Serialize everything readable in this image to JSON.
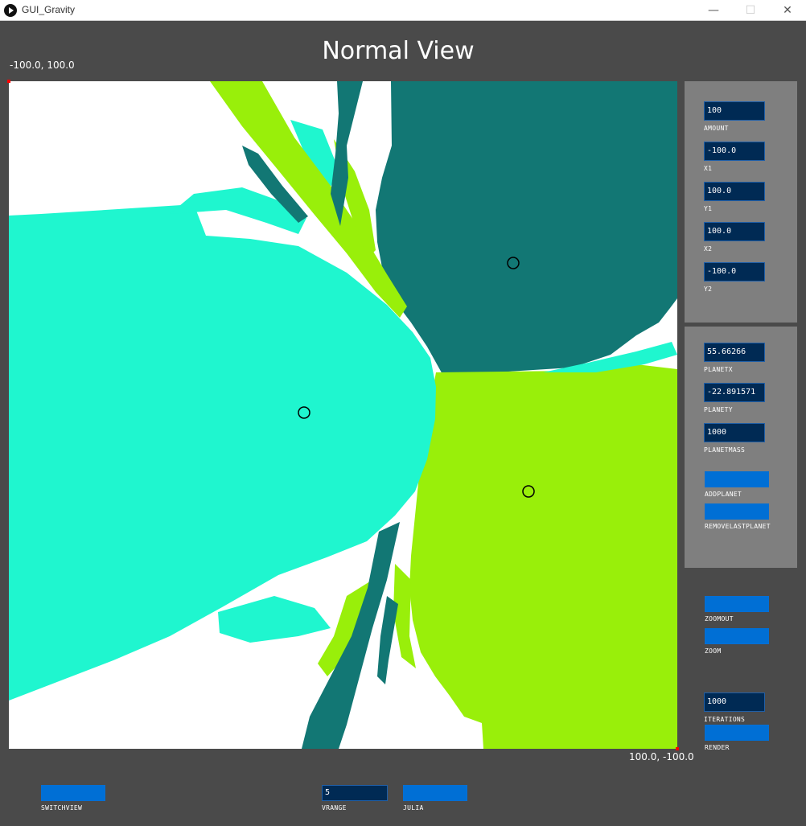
{
  "window": {
    "title": "GUI_Gravity",
    "minimize": "—",
    "maximize": "☐",
    "close": "✕"
  },
  "view_title": "Normal View",
  "coords": {
    "top_left": "-100.0, 100.0",
    "bottom_right": "100.0, -100.0"
  },
  "canvas": {
    "colors": {
      "cyan": "#1ff6cf",
      "teal": "#127774",
      "lime": "#99ef0a",
      "white": "#ffffff"
    },
    "planets": [
      {
        "name": "planet-1"
      },
      {
        "name": "planet-2"
      },
      {
        "name": "planet-3"
      }
    ]
  },
  "range_panel": {
    "amount": {
      "value": "100",
      "label": "AMOUNT"
    },
    "x1": {
      "value": "-100.0",
      "label": "X1"
    },
    "y1": {
      "value": "100.0",
      "label": "Y1"
    },
    "x2": {
      "value": "100.0",
      "label": "X2"
    },
    "y2": {
      "value": "-100.0",
      "label": "Y2"
    }
  },
  "planet_panel": {
    "planetx": {
      "value": "55.66266",
      "label": "PLANETX"
    },
    "planety": {
      "value": "-22.891571",
      "label": "PLANETY"
    },
    "planetmass": {
      "value": "1000",
      "label": "PLANETMASS"
    },
    "addplanet_label": "ADDPLANET",
    "removelastplanet_label": "REMOVELASTPLANET"
  },
  "zoom": {
    "zoomout_label": "ZOOMOUT",
    "zoom_label": "ZOOM"
  },
  "render": {
    "iterations": {
      "value": "1000",
      "label": "ITERATIONS"
    },
    "render_label": "RENDER"
  },
  "bottom": {
    "switchview_label": "SWITCHVIEW",
    "vrange": {
      "value": "5",
      "label": "VRANGE"
    },
    "julia_label": "JULIA"
  }
}
